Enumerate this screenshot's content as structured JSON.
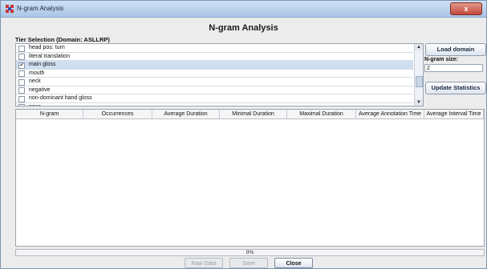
{
  "window": {
    "title": "N-gram Analysis",
    "close_label": "x"
  },
  "heading": "N-gram Analysis",
  "tier_selection": {
    "label": "Tier Selection (Domain: ASLLRP)",
    "items": [
      {
        "label": "head pos: turn",
        "checked": false,
        "selected": false
      },
      {
        "label": "literal translation",
        "checked": false,
        "selected": false
      },
      {
        "label": "main gloss",
        "checked": true,
        "selected": true
      },
      {
        "label": "mouth",
        "checked": false,
        "selected": false
      },
      {
        "label": "neck",
        "checked": false,
        "selected": false
      },
      {
        "label": "negative",
        "checked": false,
        "selected": false
      },
      {
        "label": "non-dominant hand gloss",
        "checked": false,
        "selected": false
      },
      {
        "label": "nose",
        "checked": false,
        "selected": false
      }
    ]
  },
  "controls": {
    "load_domain_label": "Load domain",
    "ngram_size_label": "N-gram size:",
    "ngram_size_value": "2",
    "update_statistics_label": "Update Statistics"
  },
  "table": {
    "columns": [
      "N-gram",
      "Occurrences",
      "Average Duration",
      "Minimal Duration",
      "Maximal Duration",
      "Average Annotation Time",
      "Average Interval Time"
    ],
    "rows": []
  },
  "progress": {
    "value": 0,
    "text": "0%"
  },
  "footer": {
    "raw_data_label": "Raw Data",
    "save_label": "Save",
    "close_label": "Close"
  },
  "colors": {
    "titlebar": "#aac6e6",
    "selection": "#cfdef0",
    "close_button": "#c2483a"
  }
}
